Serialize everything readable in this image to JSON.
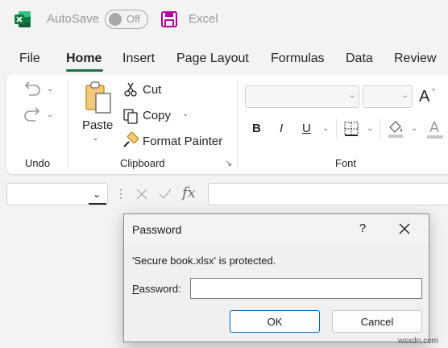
{
  "titlebar": {
    "autosave_label": "AutoSave",
    "autosave_state": "Off",
    "app_name": "Excel"
  },
  "tabs": [
    {
      "label": "File"
    },
    {
      "label": "Home",
      "active": true
    },
    {
      "label": "Insert"
    },
    {
      "label": "Page Layout"
    },
    {
      "label": "Formulas"
    },
    {
      "label": "Data"
    },
    {
      "label": "Review"
    }
  ],
  "ribbon": {
    "undo_group": "Undo",
    "clipboard": {
      "paste": "Paste",
      "cut": "Cut",
      "copy": "Copy",
      "format_painter": "Format Painter",
      "group_label": "Clipboard"
    },
    "font": {
      "bold": "B",
      "italic": "I",
      "underline": "U",
      "grow": "A",
      "font_color": "A",
      "group_label": "Font"
    }
  },
  "formula_bar": {
    "fx": "fx"
  },
  "dialog": {
    "title": "Password",
    "help": "?",
    "message": "'Secure book.xlsx' is protected.",
    "password_label_prefix": "P",
    "password_label_rest": "assword:",
    "password_value": "",
    "ok": "OK",
    "cancel": "Cancel"
  },
  "watermark": "wsxdn.com",
  "colors": {
    "accent": "#1e7145",
    "excel_green": "#107c41",
    "save_purple": "#b4009e",
    "primary_button_border": "#0067c0"
  }
}
